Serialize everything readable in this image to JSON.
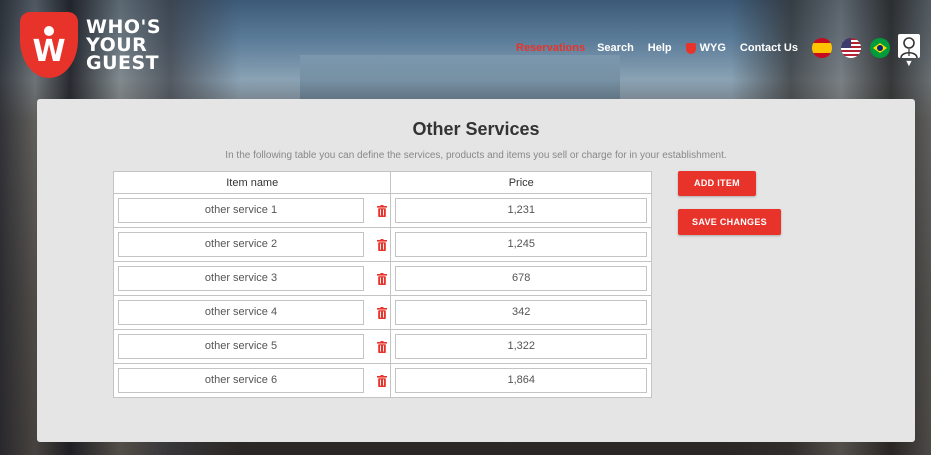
{
  "brand": {
    "logo_mark": "W",
    "lines": [
      "WHO'S",
      "YOUR",
      "GUEST"
    ],
    "color": "#e8332b"
  },
  "nav": {
    "items": [
      {
        "label": "Reservations",
        "active": true
      },
      {
        "label": "Search",
        "active": false
      },
      {
        "label": "Help",
        "active": false
      },
      {
        "label": "WYG",
        "active": false,
        "icon": "wyg-shield-icon"
      },
      {
        "label": "Contact Us",
        "active": false
      }
    ],
    "languages": [
      "spain-flag-icon",
      "usa-flag-icon",
      "brazil-flag-icon"
    ],
    "user_menu_icon": "user-avatar-icon"
  },
  "page": {
    "title": "Other Services",
    "subtitle": "In the following table you can define the services, products and items you sell or charge for in your establishment."
  },
  "table": {
    "columns": [
      "Item name",
      "Price"
    ],
    "rows": [
      {
        "name": "other service 1",
        "price": "1,231"
      },
      {
        "name": "other service 2",
        "price": "1,245"
      },
      {
        "name": "other service 3",
        "price": "678"
      },
      {
        "name": "other service 4",
        "price": "342"
      },
      {
        "name": "other service 5",
        "price": "1,322"
      },
      {
        "name": "other service 6",
        "price": "1,864"
      }
    ],
    "delete_icon": "trash-icon"
  },
  "actions": {
    "add_item": "ADD ITEM",
    "save_changes": "SAVE CHANGES"
  }
}
